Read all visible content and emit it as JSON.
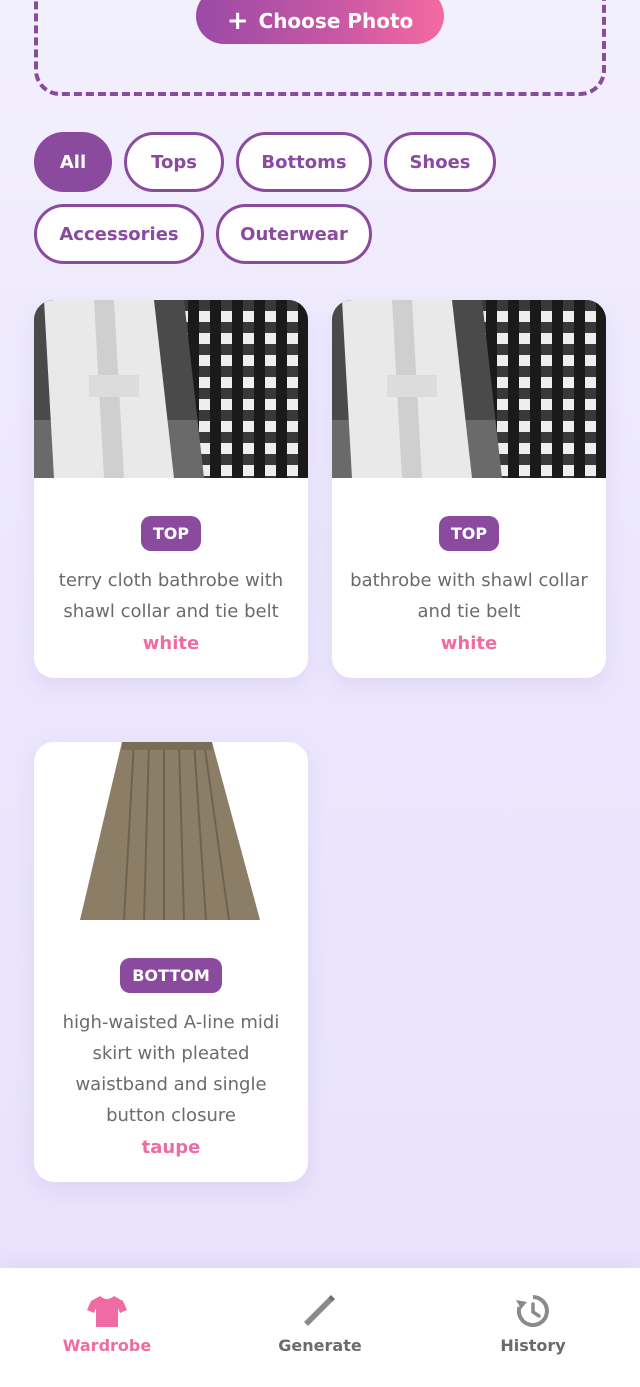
{
  "upload": {
    "button_label": "Choose Photo",
    "icon": "plus-icon"
  },
  "filters": [
    "All",
    "Tops",
    "Bottoms",
    "Shoes",
    "Accessories",
    "Outerwear"
  ],
  "active_filter": "All",
  "items": [
    {
      "category": "TOP",
      "description": "terry cloth bathrobe with shawl collar and tie belt",
      "color": "white",
      "image": "bathrobe-and-plaid-shirt-photo"
    },
    {
      "category": "TOP",
      "description": "bathrobe with shawl collar and tie belt",
      "color": "white",
      "image": "bathrobe-and-plaid-shirt-photo"
    },
    {
      "category": "BOTTOM",
      "description": "high-waisted A-line midi skirt with pleated waistband and single button closure",
      "color": "taupe",
      "image": "taupe-skirt-photo"
    }
  ],
  "nav": [
    {
      "label": "Wardrobe",
      "icon": "tshirt-icon",
      "active": true
    },
    {
      "label": "Generate",
      "icon": "wand-icon",
      "active": false
    },
    {
      "label": "History",
      "icon": "history-icon",
      "active": false
    }
  ],
  "colors": {
    "primary": "#8a4a9e",
    "accent": "#f06ba3",
    "background": "#ece7fd"
  }
}
